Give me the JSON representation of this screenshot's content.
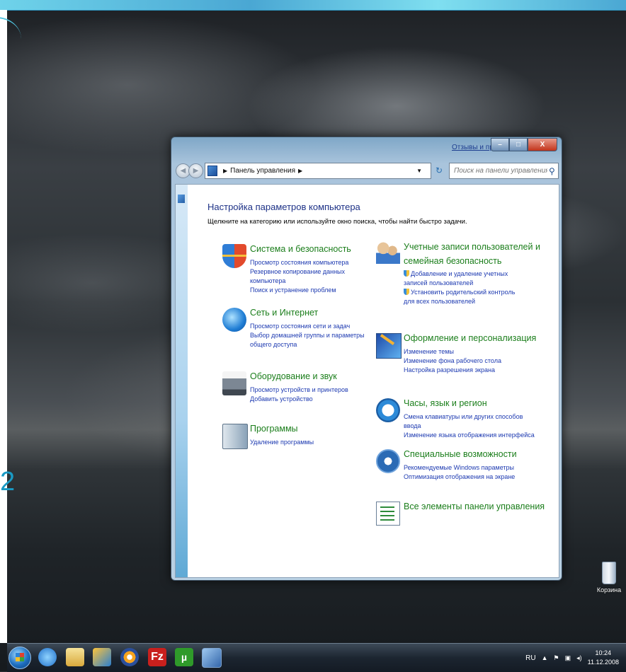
{
  "window": {
    "feedback_link": "Отзывы и предложения",
    "caption": {
      "minimize": "–",
      "maximize": "□",
      "close": "X"
    }
  },
  "nav": {
    "address_path": "Панель управления",
    "search_placeholder": "Поиск на панели управления"
  },
  "content": {
    "title": "Настройка параметров компьютера",
    "subtitle": "Щелкните на категорию или используйте окно поиска, чтобы найти быстро задачи.",
    "categories_left": [
      {
        "title": "Система и безопасность",
        "icon": "shield-icon",
        "links": [
          "Просмотр состояния компьютера",
          "Резервное копирование данных компьютера",
          "Поиск и устранение проблем"
        ]
      },
      {
        "title": "Сеть и Интернет",
        "icon": "network-icon",
        "links": [
          "Просмотр состояния сети и задач",
          "Выбор домашней группы и параметры общего доступа"
        ]
      },
      {
        "title": "Оборудование и звук",
        "icon": "printer-icon",
        "links": [
          "Просмотр устройств и принтеров",
          "Добавить устройство"
        ]
      },
      {
        "title": "Программы",
        "icon": "programs-icon",
        "links": [
          "Удаление программы"
        ]
      }
    ],
    "categories_right": [
      {
        "title": "Учетные записи пользователей и семейная безопасность",
        "icon": "users-icon",
        "links": [
          "Добавление и удаление учетных записей пользователей",
          "Установить родительский контроль для всех пользователей"
        ]
      },
      {
        "title": "Оформление и персонализация",
        "icon": "appearance-icon",
        "links": [
          "Изменение темы",
          "Изменение фона рабочего стола",
          "Настройка разрешения экрана"
        ]
      },
      {
        "title": "Часы, язык и регион",
        "icon": "clock-globe-icon",
        "links": [
          "Смена клавиатуры или других способов ввода",
          "Изменение языка отображения интерфейса"
        ]
      },
      {
        "title": "Специальные возможности",
        "icon": "accessibility-icon",
        "links": [
          "Рекомендуемые Windows параметры",
          "Оптимизация отображения на экране"
        ]
      },
      {
        "title": "Все элементы панели управления",
        "icon": "list-icon",
        "links": []
      }
    ]
  },
  "desktop": {
    "recycle_bin_label": "Корзина"
  },
  "taskbar": {
    "fz_label": "Fz",
    "mu_label": "µ",
    "language": "RU",
    "tray_up": "▲",
    "tray_flag": "⚑",
    "tray_network": "▣",
    "tray_volume": "◂)",
    "time": "10:24",
    "date": "11.12.2008"
  },
  "slide_edge_glyph": "2"
}
